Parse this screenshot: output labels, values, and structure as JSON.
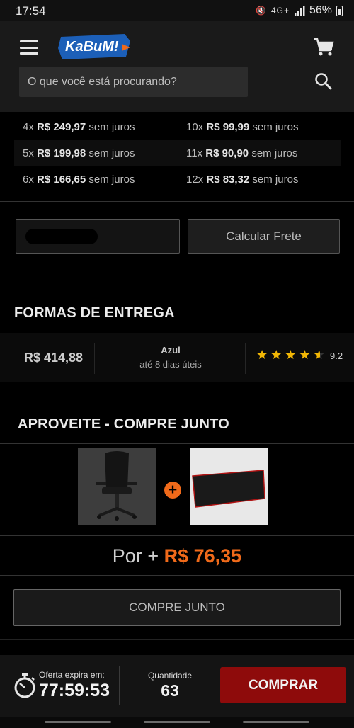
{
  "status_bar": {
    "time": "17:54",
    "network": "4G+",
    "battery": "56%"
  },
  "header": {
    "logo_text": "KaBuM!",
    "search": {
      "placeholder": "O que você está procurando?"
    }
  },
  "installments": [
    {
      "left": {
        "times": "4x",
        "amount": "R$ 249,97",
        "suffix": "sem juros"
      },
      "right": {
        "times": "10x",
        "amount": "R$ 99,99",
        "suffix": "sem juros"
      }
    },
    {
      "left": {
        "times": "5x",
        "amount": "R$ 199,98",
        "suffix": "sem juros"
      },
      "right": {
        "times": "11x",
        "amount": "R$ 90,90",
        "suffix": "sem juros"
      }
    },
    {
      "left": {
        "times": "6x",
        "amount": "R$ 166,65",
        "suffix": "sem juros"
      },
      "right": {
        "times": "12x",
        "amount": "R$ 83,32",
        "suffix": "sem juros"
      }
    }
  ],
  "shipping": {
    "button_label": "Calcular Frete"
  },
  "delivery": {
    "title": "FORMAS DE ENTREGA",
    "price": "R$ 414,88",
    "carrier": "Azul",
    "eta": "até 8 dias úteis",
    "rating": "9.2",
    "stars": 4.5,
    "star_color": "#f2b705"
  },
  "combo": {
    "title": "APROVEITE - COMPRE JUNTO",
    "price_prefix": "Por +",
    "price": "R$ 76,35",
    "button_label": "COMPRE JUNTO",
    "accent_color": "#f06a1a"
  },
  "bottom_bar": {
    "timer_label": "Oferta expira em:",
    "timer_value": "77:59:53",
    "quantity_label": "Quantidade",
    "quantity_value": "63",
    "buy_label": "COMPRAR",
    "buy_color": "#8e0b0b"
  }
}
